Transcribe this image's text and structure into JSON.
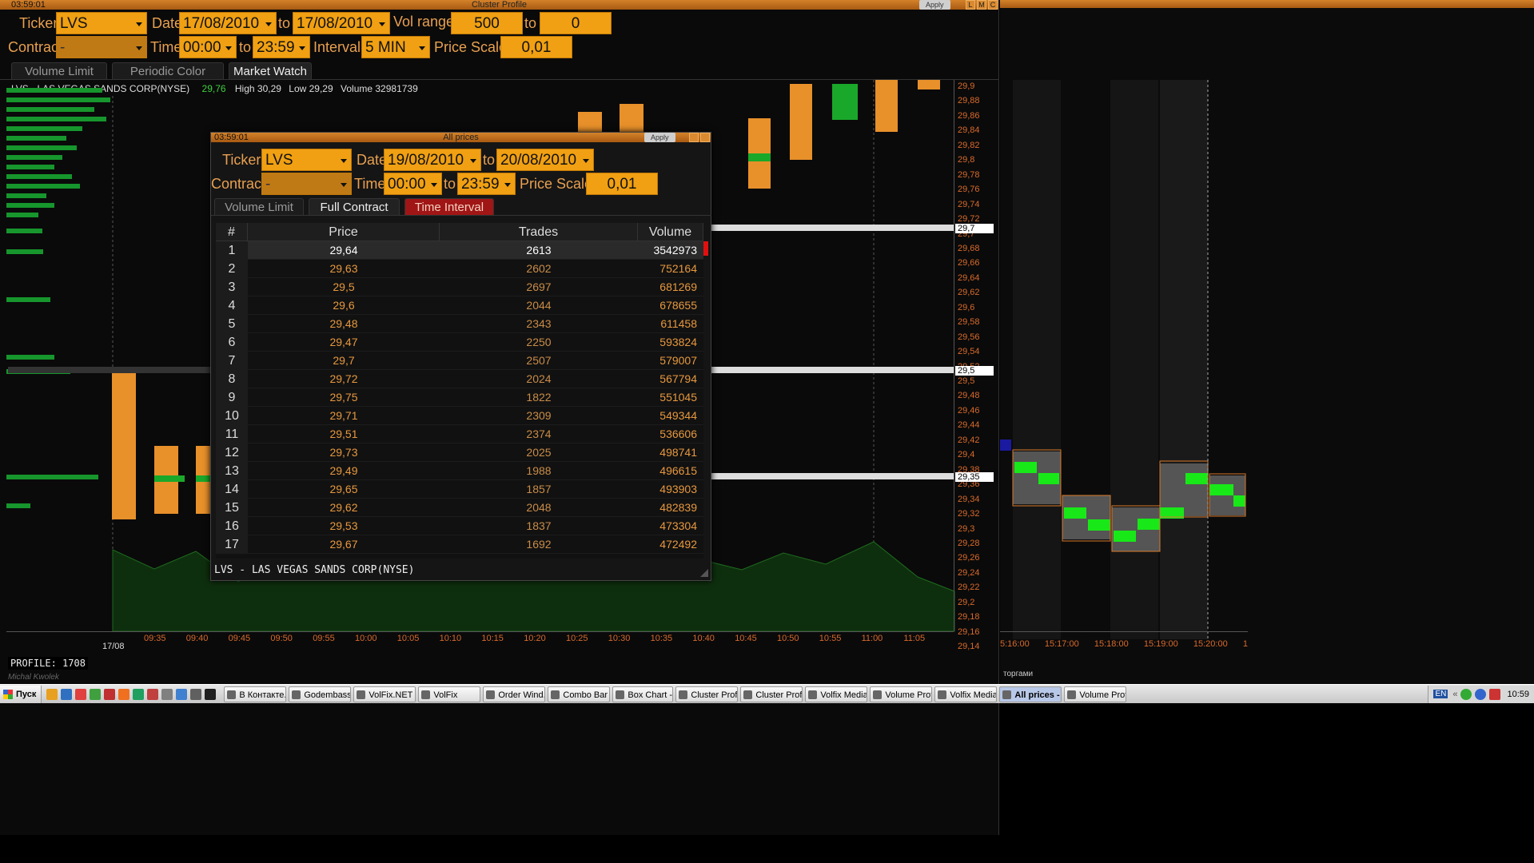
{
  "main_window": {
    "title": "Cluster Profile",
    "time": "03:59:01",
    "apply": "Apply",
    "win_buttons": [
      "L",
      "M",
      "C"
    ],
    "ticker_label": "Ticker",
    "ticker": "LVS",
    "date_label": "Date",
    "date_from": "17/08/2010",
    "to_label": "to",
    "date_to": "17/08/2010",
    "vol_range_label": "Vol range",
    "vol_from": "500",
    "vol_to_label": "to",
    "vol_to": "0",
    "contract_label": "Contract",
    "contract": "-",
    "time_label": "Time",
    "time_from": "00:00",
    "time_to_label": "to",
    "time_to": "23:59",
    "interval_label": "Interval",
    "interval": "5 MIN",
    "price_scale_label": "Price Scale",
    "price_scale": "0,01",
    "tabs": [
      "Volume Limit",
      "Periodic Color",
      "Market Watch"
    ],
    "instrument_line": "LVS - LAS VEGAS SANDS CORP(NYSE)",
    "last": "29,76",
    "high": "High 30,29",
    "low": "Low 29,29",
    "volume": "Volume 32981739",
    "profile": "PROFILE: 1708",
    "watermark": "Michal Kwolek",
    "date_tick": "17/08",
    "time_ticks": [
      "09:35",
      "09:40",
      "09:45",
      "09:50",
      "09:55",
      "10:00",
      "10:05",
      "10:10",
      "10:15",
      "10:20",
      "10:25",
      "10:30",
      "10:35",
      "10:40",
      "10:45",
      "10:50",
      "10:55",
      "11:00",
      "11:05"
    ],
    "price_ticks": [
      "29,9",
      "29,88",
      "29,86",
      "29,84",
      "29,82",
      "29,8",
      "29,78",
      "29,76",
      "29,74",
      "29,72",
      "29,7",
      "29,68",
      "29,66",
      "29,64",
      "29,62",
      "29,6",
      "29,58",
      "29,56",
      "29,54",
      "29,52",
      "29,5",
      "29,48",
      "29,46",
      "29,44",
      "29,42",
      "29,4",
      "29,38",
      "29,36",
      "29,34",
      "29,32",
      "29,3",
      "29,28",
      "29,26",
      "29,24",
      "29,22",
      "29,2",
      "29,18",
      "29,16",
      "29,14"
    ],
    "marker_labels": [
      "29,7",
      "29,5",
      "29,35"
    ]
  },
  "right_panel": {
    "time_ticks": [
      "5:16:00",
      "15:17:00",
      "15:18:00",
      "15:19:00",
      "15:20:00",
      "1"
    ],
    "footer": "торгами"
  },
  "prices_window": {
    "title": "All prices",
    "time": "03:59:01",
    "apply": "Apply",
    "ticker_label": "Ticker",
    "ticker": "LVS",
    "date_label": "Date",
    "date_from": "19/08/2010",
    "to_label": "to",
    "date_to": "20/08/2010",
    "contract_label": "Contract",
    "contract": "-",
    "time_label": "Time",
    "time_from": "00:00",
    "time_to_label": "to",
    "time_to": "23:59",
    "price_scale_label": "Price Scale",
    "price_scale": "0,01",
    "tabs": [
      "Volume Limit",
      "Full Contract",
      "Time Interval"
    ],
    "columns": [
      "#",
      "Price",
      "Trades",
      "Volume"
    ],
    "rows": [
      [
        "1",
        "29,64",
        "2613",
        "3542973"
      ],
      [
        "2",
        "29,63",
        "2602",
        "752164"
      ],
      [
        "3",
        "29,5",
        "2697",
        "681269"
      ],
      [
        "4",
        "29,6",
        "2044",
        "678655"
      ],
      [
        "5",
        "29,48",
        "2343",
        "611458"
      ],
      [
        "6",
        "29,47",
        "2250",
        "593824"
      ],
      [
        "7",
        "29,7",
        "2507",
        "579007"
      ],
      [
        "8",
        "29,72",
        "2024",
        "567794"
      ],
      [
        "9",
        "29,75",
        "1822",
        "551045"
      ],
      [
        "10",
        "29,71",
        "2309",
        "549344"
      ],
      [
        "11",
        "29,51",
        "2374",
        "536606"
      ],
      [
        "12",
        "29,73",
        "2025",
        "498741"
      ],
      [
        "13",
        "29,49",
        "1988",
        "496615"
      ],
      [
        "14",
        "29,65",
        "1857",
        "493903"
      ],
      [
        "15",
        "29,62",
        "2048",
        "482839"
      ],
      [
        "16",
        "29,53",
        "1837",
        "473304"
      ],
      [
        "17",
        "29,67",
        "1692",
        "472492"
      ]
    ],
    "footer": "LVS - LAS VEGAS SANDS CORP(NYSE)"
  },
  "taskbar": {
    "start": "Пуск",
    "items": [
      "В Контакте...",
      "Godembass...",
      "VolFix.NET",
      "VolFix",
      "Order Wind...",
      "Combo Bar ...",
      "Box Chart - ...",
      "Cluster Prof...",
      "Cluster Prof...",
      "Volfix Media...",
      "Volume Prof...",
      "Volfix Media...",
      "All prices - ...",
      "Volume Prof..."
    ],
    "active_index": 12,
    "lang": "EN",
    "clock": "10:59"
  }
}
